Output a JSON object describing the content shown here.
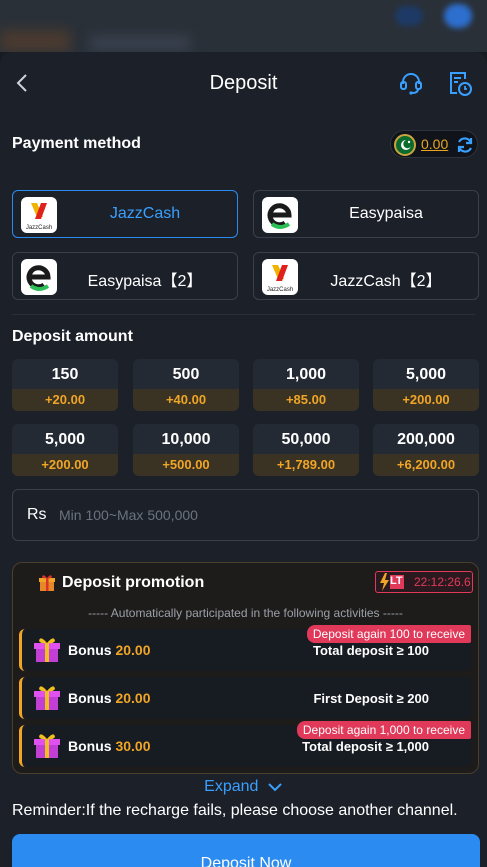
{
  "header": {
    "title": "Deposit"
  },
  "payment": {
    "label": "Payment method",
    "balance": "0.00",
    "methods": [
      {
        "name": "JazzCash",
        "logo": "jazzcash-logo",
        "active": true
      },
      {
        "name": "Easypaisa",
        "logo": "easypaisa-logo",
        "active": false
      },
      {
        "name": "Easypaisa【2】",
        "logo": "easypaisa-logo",
        "active": false
      },
      {
        "name": "JazzCash【2】",
        "logo": "jazzcash-logo",
        "active": false
      }
    ]
  },
  "amount": {
    "label": "Deposit amount",
    "options": [
      {
        "value": "150",
        "bonus": "+20.00"
      },
      {
        "value": "500",
        "bonus": "+40.00"
      },
      {
        "value": "1,000",
        "bonus": "+85.00"
      },
      {
        "value": "5,000",
        "bonus": "+200.00"
      },
      {
        "value": "5,000",
        "bonus": "+200.00"
      },
      {
        "value": "10,000",
        "bonus": "+500.00"
      },
      {
        "value": "50,000",
        "bonus": "+1,789.00"
      },
      {
        "value": "200,000",
        "bonus": "+6,200.00"
      }
    ],
    "currency": "Rs",
    "placeholder": "Min 100~Max 500,000"
  },
  "promotion": {
    "title": "Deposit promotion",
    "badge": "LT",
    "countdown": "22:12:26.6",
    "subtitle": "----- Automatically participated in the following activities -----",
    "activities": [
      {
        "label": "Bonus",
        "amount": "20.00",
        "condition": "Total deposit ≥ 100",
        "tag": "Deposit again 100 to receive"
      },
      {
        "label": "Bonus",
        "amount": "20.00",
        "condition": "First Deposit ≥ 200",
        "tag": ""
      },
      {
        "label": "Bonus",
        "amount": "30.00",
        "condition": "Total deposit ≥ 1,000",
        "tag": "Deposit again 1,000 to receive"
      }
    ]
  },
  "expand_label": "Expand",
  "reminder": "Reminder:If the recharge fails, please choose another channel.",
  "deposit_button": "Deposit Now",
  "colors": {
    "accent": "#2b8bf0",
    "bonus": "#f0a526",
    "danger": "#e0395a"
  }
}
